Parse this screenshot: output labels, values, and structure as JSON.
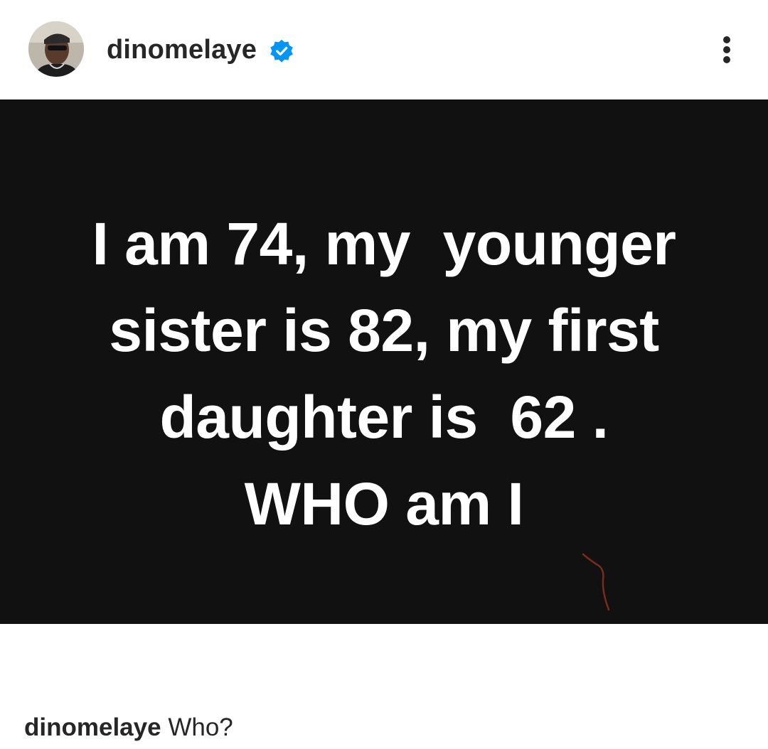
{
  "header": {
    "username": "dinomelaye",
    "verified_icon": "verified-badge-icon",
    "more_icon": "more-options-icon",
    "avatar_icon": "profile-avatar"
  },
  "image": {
    "lines": [
      "I am 74, my  younger",
      "sister is 82, my first",
      "daughter is  62 .",
      "WHO am I"
    ],
    "background": "#111111",
    "text_color": "#ffffff"
  },
  "caption": {
    "username": "dinomelaye",
    "text": "Who?"
  },
  "colors": {
    "verified": "#0095f6",
    "text": "#262626"
  }
}
